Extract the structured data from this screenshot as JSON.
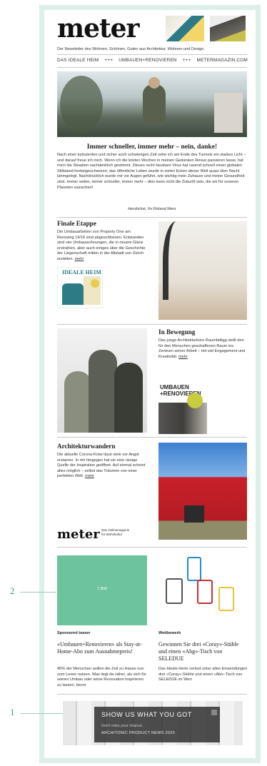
{
  "header": {
    "logo": "meter",
    "tagline": "Der Newsletter des Wohnen, Schönen, Guten aus Architektur, Wohnen und Design."
  },
  "nav": {
    "items": [
      "DAS IDEALE HEIM",
      "+++",
      "UMBAUEN+RENOVIEREN",
      "+++",
      "METERMAGAZIN.COM"
    ]
  },
  "intro": {
    "title": "Immer schneller, immer mehr – nein, danke!",
    "body": "Nach einer turbulenten und sicher auch schwierigen Zeit sehe ich am Ende des Tunnels ein starkes Licht – und darauf freue ich mich. Wenn ich die letzten Wochen in meinen Gedanken Revue passieren lasse, hat mich die Situation nachdenklich gestimmt. Dieses recht fassbare Virus hat rasend schnell einen globalen Stillstand herbeigeschworen, das öffentliche Leben wurde in vielen Ecken dieser Welt quasi über Nacht lahmgelegt. Nachdrücklich wurde mir vor Augen geführt, wie wichtig mein Zuhause und meine Gesundheit sind.",
    "body2": "Immer weiter, immer schneller, immer mehr – dies kann nicht die Zukunft sein, die wir für unseren Planeten wünschen!",
    "signature": "Herzlichst, Ihr Roland Merz"
  },
  "articles": [
    {
      "title": "Finale Etappe",
      "body": "Die Umbauarbeiten von Property One am Rennweg 14/16 sind abgeschlossen. Entstanden sind vier Umbauwohnungen, die in neuem Glanz erstrahlen, aber auch einiges über die Geschichte der Liegenschaft mitten in der Altstadt von Zürich erzählen.",
      "more": "mehr",
      "cover": "IDEALE HEIM"
    },
    {
      "title": "In Bewegung",
      "body": "Das junge Architekturbüro Raumfaltigg stellt den für den Menschen geschaffenen Raum ins Zentrum seiner Arbeit – mit viel Engagement und Kreativität.",
      "more": "mehr",
      "cover": "UMBAUEN +RENOVIEREN"
    },
    {
      "title": "Architekturwandern",
      "body": "Die aktuelle Corona-Krise lässt viele vor Angst erstarren. In mir hingegen hat sie eine riesige Quelle der Inspiration geöffnet. Auf einmal scheint alles möglich – selbst das Träumen von einer perfekten Welt.",
      "more": "mehr",
      "logo": "meter",
      "logo_sub": "Das Onlinemagazin für Wohnkultur"
    }
  ],
  "promos": [
    {
      "label": "Sponsored teaser",
      "title": "«Umbauen+Renovieren» als Stay-at-Home-Abo zum Ausnahmepreis!",
      "body": "45% der Menschen wollen die Zeit zu Hause nun zum Lesen nutzen. Was liegt da näher, als sich für seinen Umbau oder seine Renovation inspirieren zu lassen, bevor",
      "image_text": "1 Bild"
    },
    {
      "label": "Wettbewerb",
      "title": "Gewinnen Sie drei «Coray»-Stühle und einen «Abg»-Tisch von SELEDUE",
      "body": "Das Ideale Heim verlost unter allen Einsendungen drei «Coray»-Stühle und einen «Abl»-Tisch von SELEDUE im Wert"
    }
  ],
  "popup": {
    "title": "SHOW US WHAT YOU GOT",
    "subtitle": "Don't miss your chance.",
    "name": "ARCHITONIC PRODUCT NEWS 2020"
  },
  "callouts": [
    "1",
    "2"
  ],
  "colors": {
    "frame": "#dcefe9",
    "teal_block": "#6dc39d",
    "callout": "#3a9c8a"
  }
}
